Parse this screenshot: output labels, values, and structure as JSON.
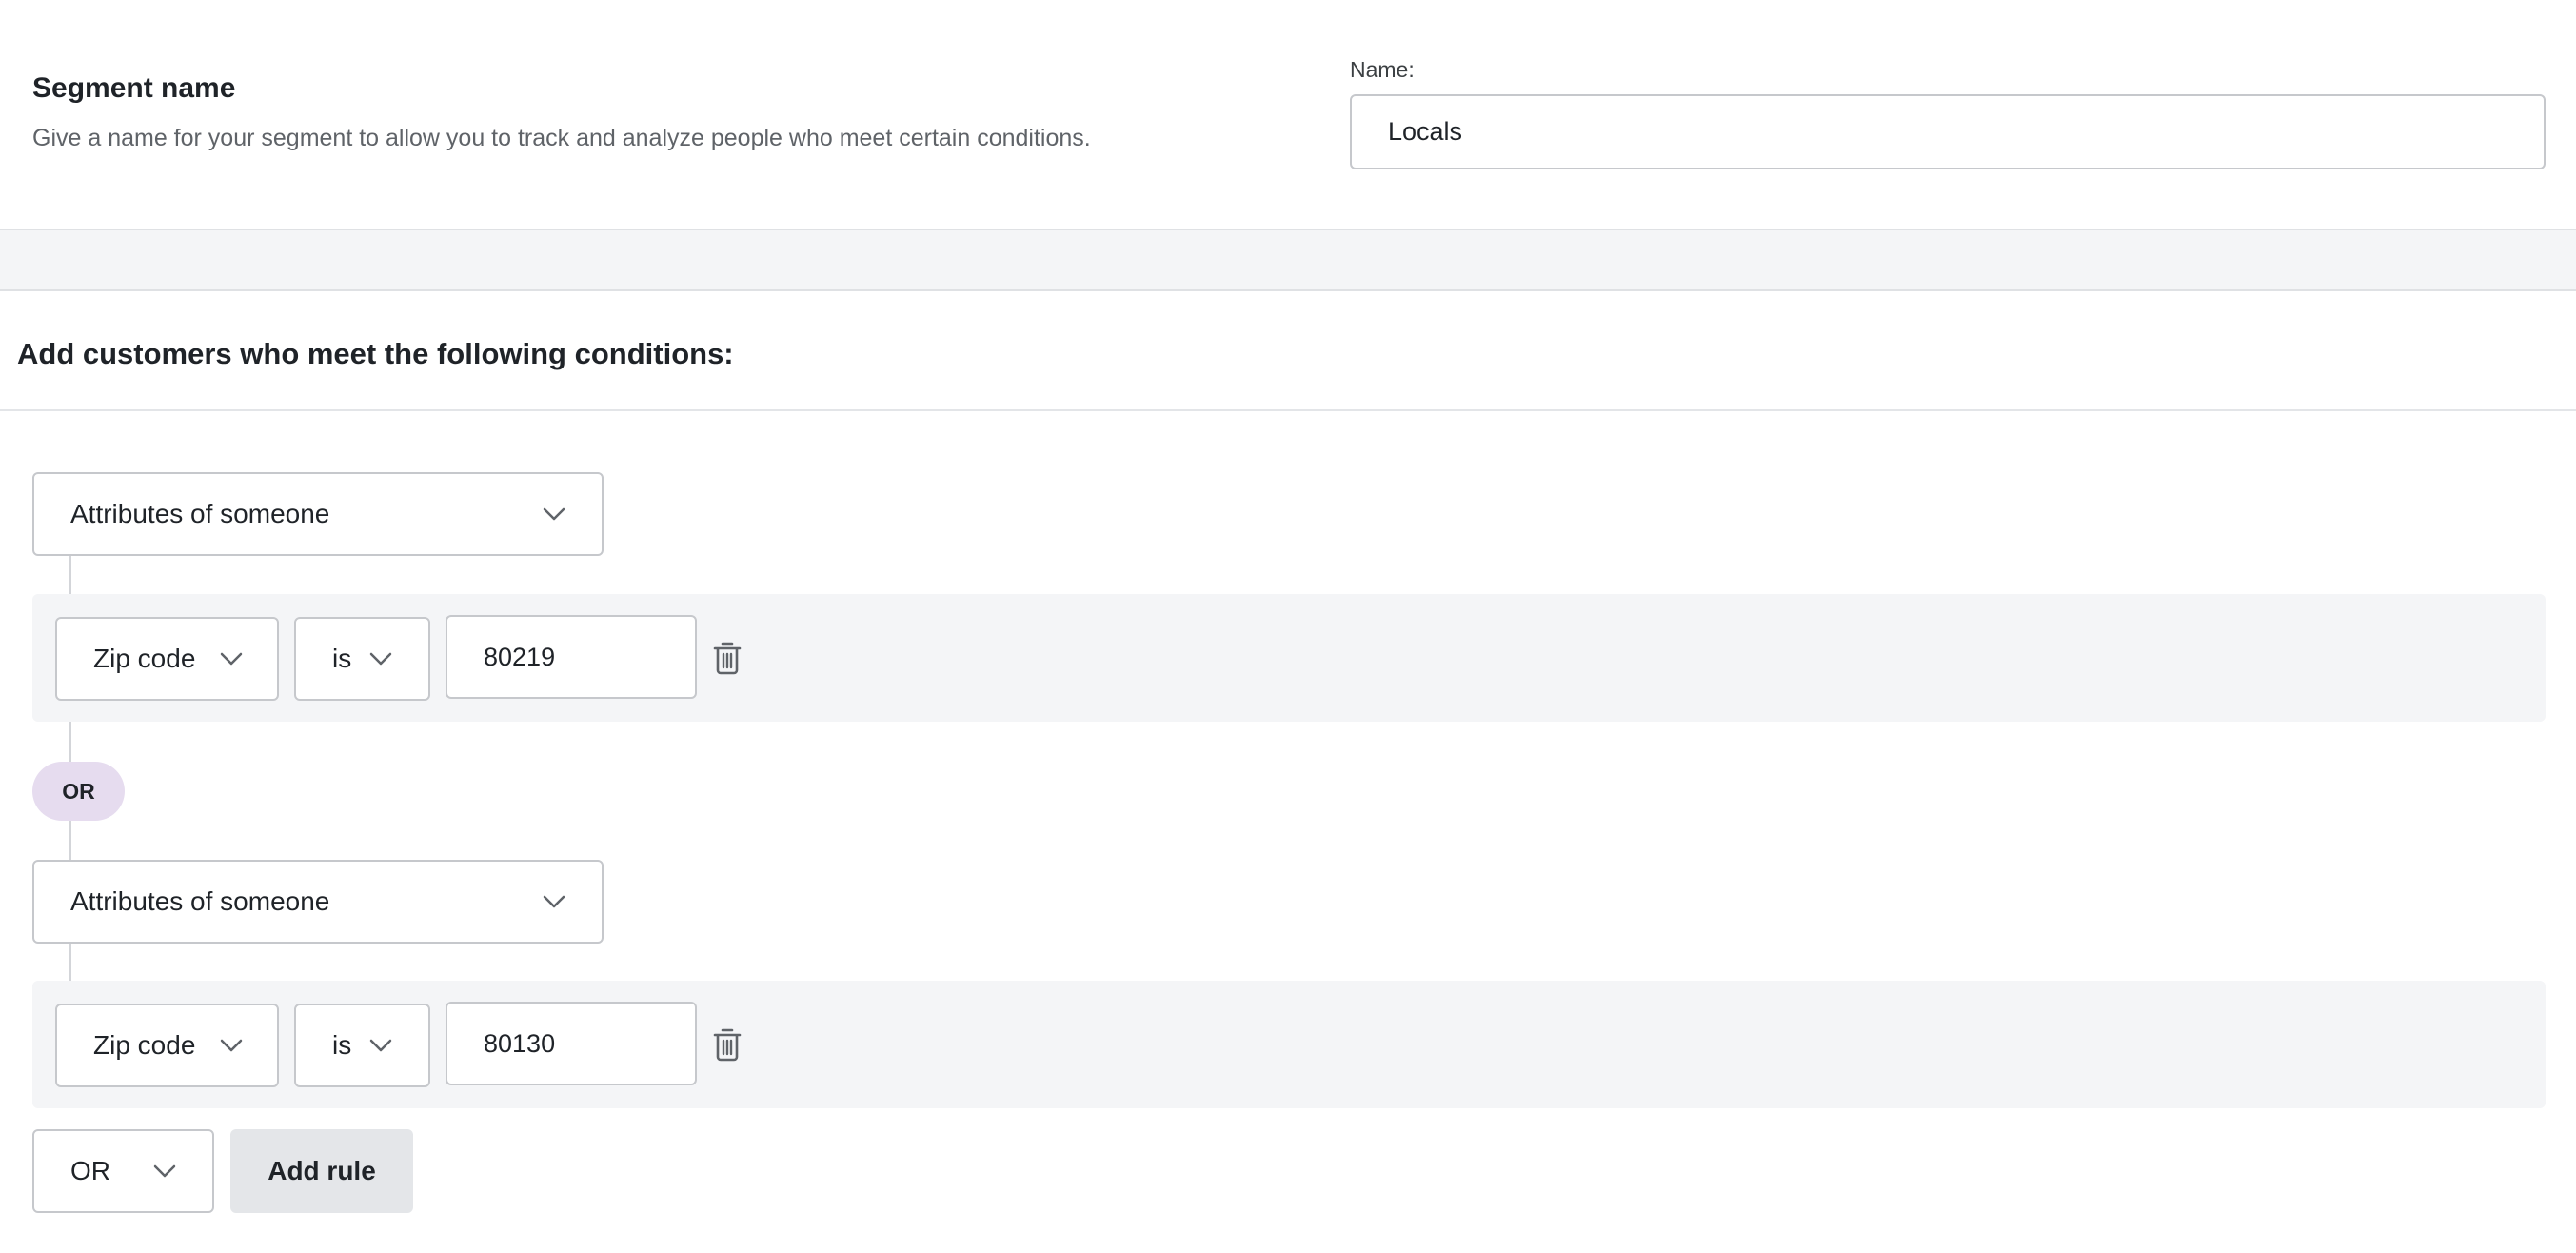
{
  "segment_name": {
    "title": "Segment name",
    "description": "Give a name for your segment to allow you to track and analyze people who meet certain conditions.",
    "name_label": "Name:",
    "name_value": "Locals"
  },
  "conditions": {
    "title": "Add customers who meet the following conditions:",
    "groups": [
      {
        "source": "Attributes of someone",
        "rule": {
          "field": "Zip code",
          "operator": "is",
          "value": "80219"
        }
      },
      {
        "source": "Attributes of someone",
        "rule": {
          "field": "Zip code",
          "operator": "is",
          "value": "80130"
        }
      }
    ],
    "separator": "OR",
    "combinator": "OR",
    "add_rule_label": "Add rule"
  },
  "icons": {
    "chevron": "chevron-down-icon",
    "delete": "trash-icon"
  },
  "colors": {
    "or_badge": "#e6dcef",
    "add_rule_bg": "#e4e6e9",
    "rule_row_bg": "#f4f5f7"
  }
}
